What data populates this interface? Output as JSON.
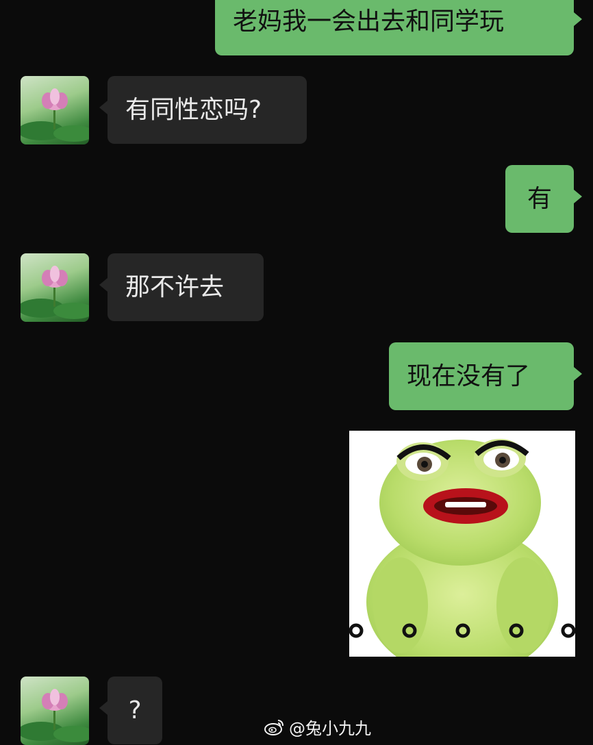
{
  "messages": [
    {
      "sender": "me",
      "text": "老妈我一会出去和同学玩"
    },
    {
      "sender": "other",
      "text": "有同性恋吗?"
    },
    {
      "sender": "me",
      "text": "有"
    },
    {
      "sender": "other",
      "text": "那不许去"
    },
    {
      "sender": "me",
      "text": "现在没有了"
    },
    {
      "sender": "me",
      "type": "sticker",
      "sticker": "frog-with-lipstick-sticker"
    },
    {
      "sender": "other",
      "text": "?"
    }
  ],
  "avatar": {
    "icon": "lotus-flower-avatar"
  },
  "watermark": {
    "text": "@兔小九九",
    "icon": "weibo-icon"
  },
  "colors": {
    "background": "#0b0b0b",
    "my_bubble": "#6aba6c",
    "other_bubble": "#262626"
  }
}
